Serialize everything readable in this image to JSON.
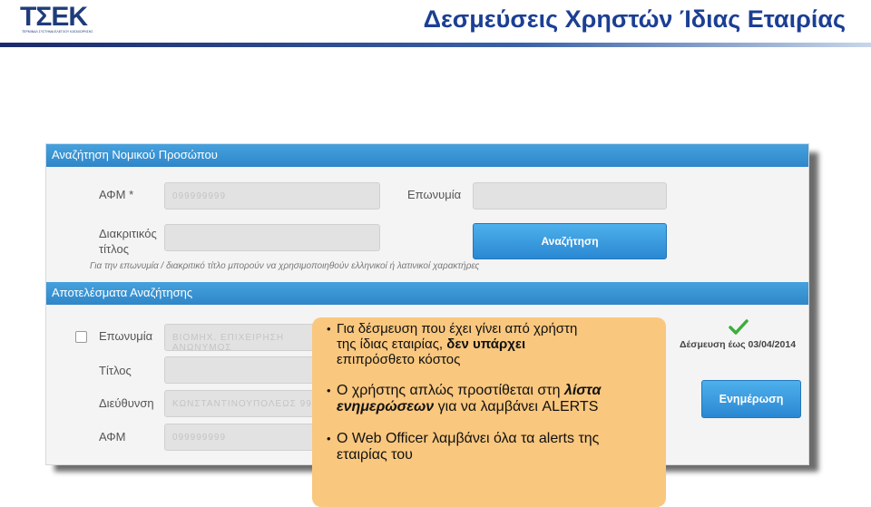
{
  "header": {
    "logo_text": "ΤΣΕΚ",
    "logo_subtext": "ΤΕΡΜΙΝΑΛ ΣΥΣΤΗΜΑ ΕΛΕΓΧΟΥ ΚΑΤΑΧΩΡΗΣΗΣ",
    "title": "Δεσμεύσεις Χρηστών Ίδιας Εταιρίας",
    "colors": {
      "title": "#1c3f94",
      "rule": "#1a2a6c"
    }
  },
  "search_section": {
    "title": "Αναζήτηση Νομικού Προσώπου",
    "afm_label": "ΑΦΜ *",
    "afm_value": "099999999",
    "eponymia_label": "Επωνυμία",
    "eponymia_value": "",
    "diakritikos_label_1": "Διακριτικός",
    "diakritikos_label_2": "τίτλος",
    "diakritikos_value": "",
    "search_button": "Αναζήτηση",
    "hint": "Για την επωνυμία / διακριτικό τίτλο μπορούν να χρησιμοποιηθούν ελληνικοί ή λατινικοί χαρακτήρες"
  },
  "results_section": {
    "title": "Αποτελέσματα Αναζήτησης",
    "eponymia_label": "Επωνυμία",
    "eponymia_value": "ΒΙΟΜΗΧ. ΕΠΙΧΕΙΡΗΣΗ ΑΝΩΝΥΜΟΣ",
    "titlos_label": "Τίτλος",
    "titlos_value": "",
    "dieuthinsi_label": "Διεύθυνση",
    "dieuthinsi_value": "ΚΩΝΣΤΑΝΤΙΝΟΥΠΟΛΕΩΣ 99",
    "afm_label": "ΑΦΜ",
    "afm_value": "099999999",
    "commit_text": "Δέσμευση έως 03/04/2014",
    "update_button": "Ενημέρωση",
    "colors": {
      "check": "#3cae3c",
      "bar": "#3a93d4"
    }
  },
  "callout": {
    "b1_line1": "Για δέσμευση που έχει γίνει από χρήστη",
    "b1_line2a": "της ίδιας εταιρίας, ",
    "b1_line2b": "δεν υπάρχει",
    "b1_line3": "επιπρόσθετο κόστος",
    "b2_line1a": "Ο χρήστης απλώς προστίθεται στη ",
    "b2_line1b": "λίστα",
    "b2_line2a": "ενημερώσεων",
    "b2_line2b": " για να λαμβάνει ALERTS",
    "b3_line1": "Ο Web Officer λαμβάνει όλα τα alerts της",
    "b3_line2": "εταιρίας του",
    "color": "#f9c77e"
  }
}
